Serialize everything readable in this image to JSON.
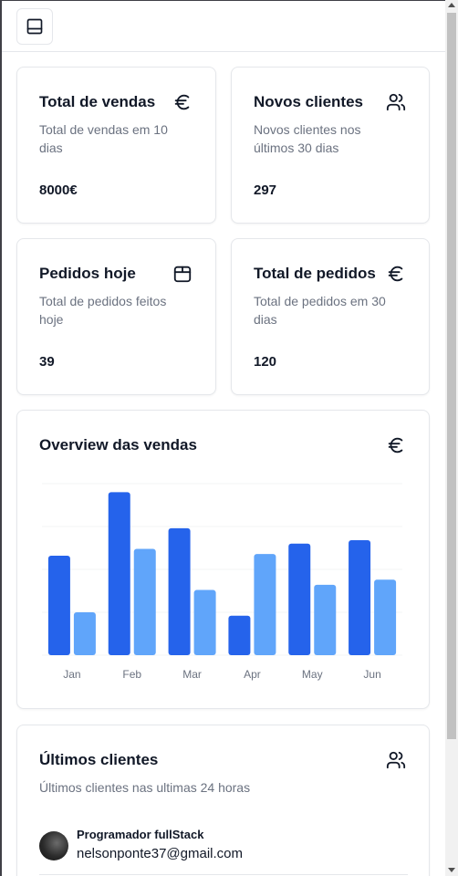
{
  "topbar": {
    "toggle_icon": "panel-bottom-icon"
  },
  "cards": [
    {
      "title": "Total de vendas",
      "description": "Total de vendas em 10 dias",
      "value": "8000€",
      "icon": "euro-icon"
    },
    {
      "title": "Novos clientes",
      "description": "Novos clientes nos últimos 30 dias",
      "value": "297",
      "icon": "users-icon"
    },
    {
      "title": "Pedidos hoje",
      "description": "Total de pedidos feitos hoje",
      "value": "39",
      "icon": "package-icon"
    },
    {
      "title": "Total de pedidos",
      "description": "Total de pedidos em 30 dias",
      "value": "120",
      "icon": "euro-icon"
    }
  ],
  "overview": {
    "title": "Overview das vendas",
    "icon": "euro-icon"
  },
  "chart_data": {
    "type": "bar",
    "title": "Overview das vendas",
    "categories": [
      "Jan",
      "Feb",
      "Mar",
      "Apr",
      "May",
      "Jun"
    ],
    "series": [
      {
        "values": [
          58,
          95,
          74,
          23,
          65,
          67
        ],
        "color": "#2563eb"
      },
      {
        "values": [
          25,
          62,
          38,
          59,
          41,
          44
        ],
        "color": "#60a5fa"
      }
    ],
    "ylim": [
      0,
      100
    ],
    "grid": true,
    "legend": "none"
  },
  "clients": {
    "title": "Últimos clientes",
    "subtitle": "Últimos clientes nas ultimas 24 horas",
    "icon": "users-icon",
    "items": [
      {
        "name": "Programador fullStack",
        "email": "nelsonponte37@gmail.com"
      }
    ]
  },
  "colors": {
    "primary_bar": "#2563eb",
    "secondary_bar": "#60a5fa",
    "border": "#e5e7eb",
    "muted_text": "#6b7280"
  }
}
